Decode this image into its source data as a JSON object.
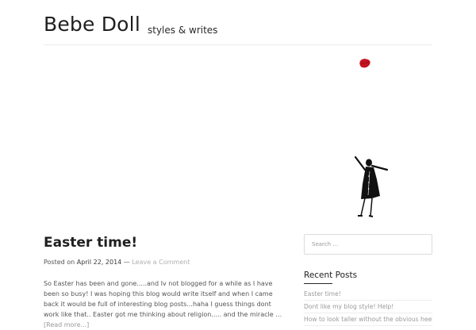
{
  "header": {
    "site_title": "Bebe Doll",
    "tagline": "styles & writes"
  },
  "post": {
    "title": "Easter time!",
    "posted_on_label": "Posted on",
    "date": "April 22, 2014",
    "separator": "—",
    "comment_link": "Leave a Comment",
    "excerpt": "So Easter has been and gone.....and Iv not blogged for a while as I have been so busy! I was hoping this blog would write itself and when I came back it would be full of interesting blog posts...haha I guess things dont work like that.. Easter got me thinking about religion..... and the miracle …",
    "read_more": "[Read more...]"
  },
  "sidebar": {
    "search_placeholder": "Search …",
    "recent_posts_title": "Recent Posts",
    "recent_posts": [
      "Easter time!",
      "Dont like my blog style! Help!",
      "How to look taller without the obvious heels"
    ]
  },
  "colors": {
    "lips": "#c41420",
    "text": "#3a3a3a",
    "link_muted": "#9a9a9a"
  }
}
